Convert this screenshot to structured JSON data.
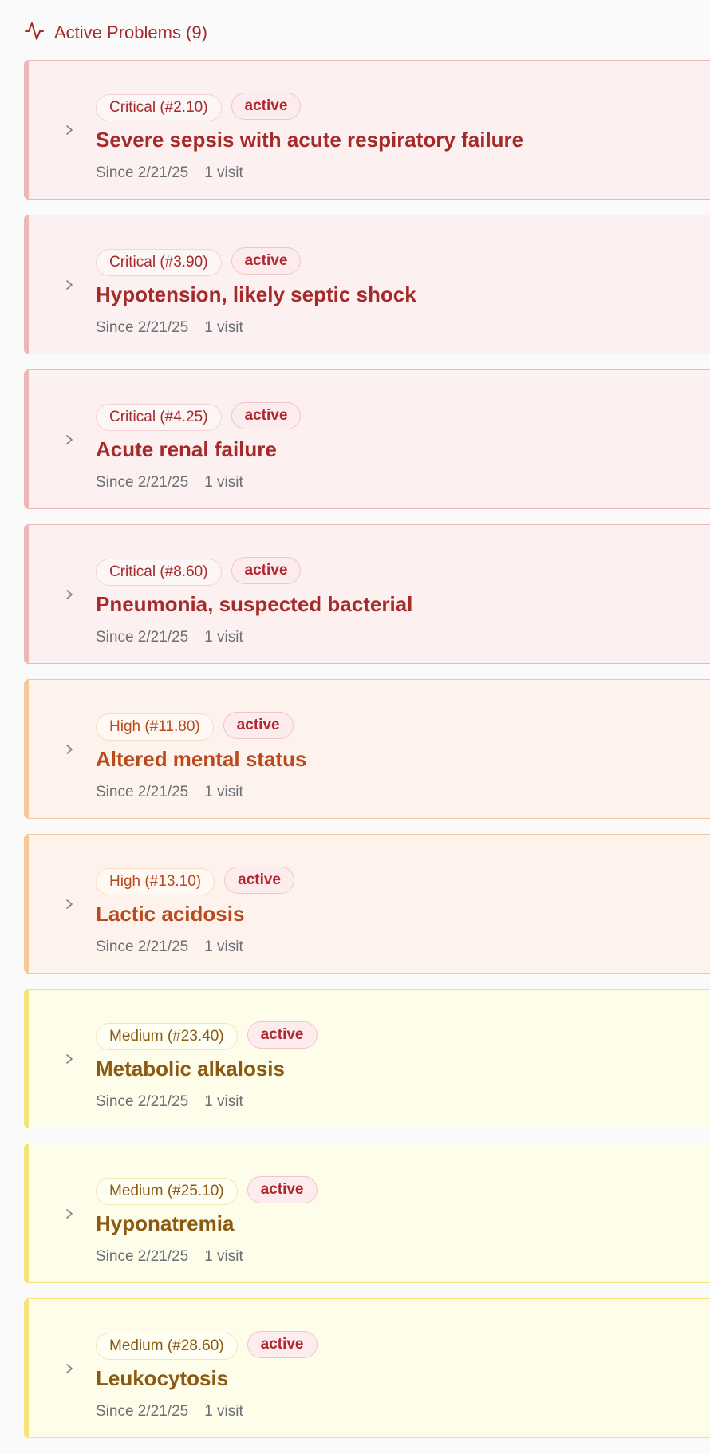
{
  "header": {
    "title": "Active Problems (9)",
    "icon": "activity-icon",
    "color": "#a52a2a"
  },
  "colors": {
    "critical": "#a52a2a",
    "high": "#b84a1c",
    "medium": "#8a5a12",
    "status": "#b2262f"
  },
  "problems": [
    {
      "priority": "Critical (#2.10)",
      "status": "active",
      "name": "Severe sepsis with acute respiratory failure",
      "since": "Since 2/21/25",
      "visits": "1 visit",
      "severity": "critical"
    },
    {
      "priority": "Critical (#3.90)",
      "status": "active",
      "name": "Hypotension, likely septic shock",
      "since": "Since 2/21/25",
      "visits": "1 visit",
      "severity": "critical"
    },
    {
      "priority": "Critical (#4.25)",
      "status": "active",
      "name": "Acute renal failure",
      "since": "Since 2/21/25",
      "visits": "1 visit",
      "severity": "critical"
    },
    {
      "priority": "Critical (#8.60)",
      "status": "active",
      "name": "Pneumonia, suspected bacterial",
      "since": "Since 2/21/25",
      "visits": "1 visit",
      "severity": "critical"
    },
    {
      "priority": "High (#11.80)",
      "status": "active",
      "name": "Altered mental status",
      "since": "Since 2/21/25",
      "visits": "1 visit",
      "severity": "high"
    },
    {
      "priority": "High (#13.10)",
      "status": "active",
      "name": "Lactic acidosis",
      "since": "Since 2/21/25",
      "visits": "1 visit",
      "severity": "high"
    },
    {
      "priority": "Medium (#23.40)",
      "status": "active",
      "name": "Metabolic alkalosis",
      "since": "Since 2/21/25",
      "visits": "1 visit",
      "severity": "medium"
    },
    {
      "priority": "Medium (#25.10)",
      "status": "active",
      "name": "Hyponatremia",
      "since": "Since 2/21/25",
      "visits": "1 visit",
      "severity": "medium"
    },
    {
      "priority": "Medium (#28.60)",
      "status": "active",
      "name": "Leukocytosis",
      "since": "Since 2/21/25",
      "visits": "1 visit",
      "severity": "medium"
    }
  ]
}
